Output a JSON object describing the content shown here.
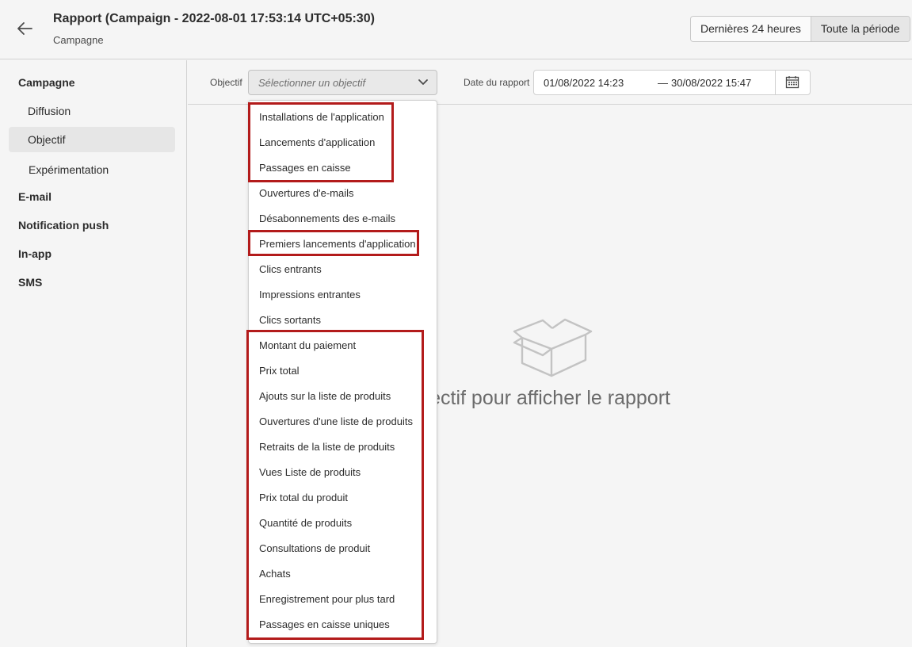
{
  "header": {
    "title": "Rapport (Campaign - 2022-08-01 17:53:14 UTC+05:30)",
    "subtitle": "Campagne",
    "ranges": [
      "Dernières 24 heures",
      "Toute la période"
    ]
  },
  "sidebar": {
    "items": [
      {
        "label": "Campagne"
      },
      {
        "label": "Diffusion"
      },
      {
        "label": "Objectif"
      },
      {
        "label": "Expérimentation"
      },
      {
        "label": "E-mail"
      },
      {
        "label": "Notification push"
      },
      {
        "label": "In-app"
      },
      {
        "label": "SMS"
      }
    ]
  },
  "filters": {
    "objective_label": "Objectif",
    "objective_placeholder": "Sélectionner un objectif",
    "date_label": "Date du rapport",
    "date_start": "01/08/2022 14:23",
    "date_separator": "—",
    "date_end": "30/08/2022 15:47"
  },
  "empty_state": {
    "text": "un objectif pour afficher le rapport"
  },
  "dropdown": {
    "options": [
      "Installations de l'application",
      "Lancements d'application",
      "Passages en caisse",
      "Ouvertures d'e-mails",
      "Désabonnements des e-mails",
      "Premiers lancements d'application",
      "Clics entrants",
      "Impressions entrantes",
      "Clics sortants",
      "Montant du paiement",
      "Prix total",
      "Ajouts sur la liste de produits",
      "Ouvertures d'une liste de  produits",
      "Retraits de la liste de produits",
      "Vues Liste de produits",
      "Prix total du produit",
      "Quantité de produits",
      "Consultations de produit",
      "Achats",
      "Enregistrement pour plus tard",
      "Passages en caisse uniques"
    ]
  },
  "colors": {
    "highlight": "#b31b1b",
    "background": "#f5f5f5"
  },
  "icons": [
    "arrow-left-icon",
    "chevron-down-icon",
    "calendar-icon",
    "empty-box-icon"
  ]
}
